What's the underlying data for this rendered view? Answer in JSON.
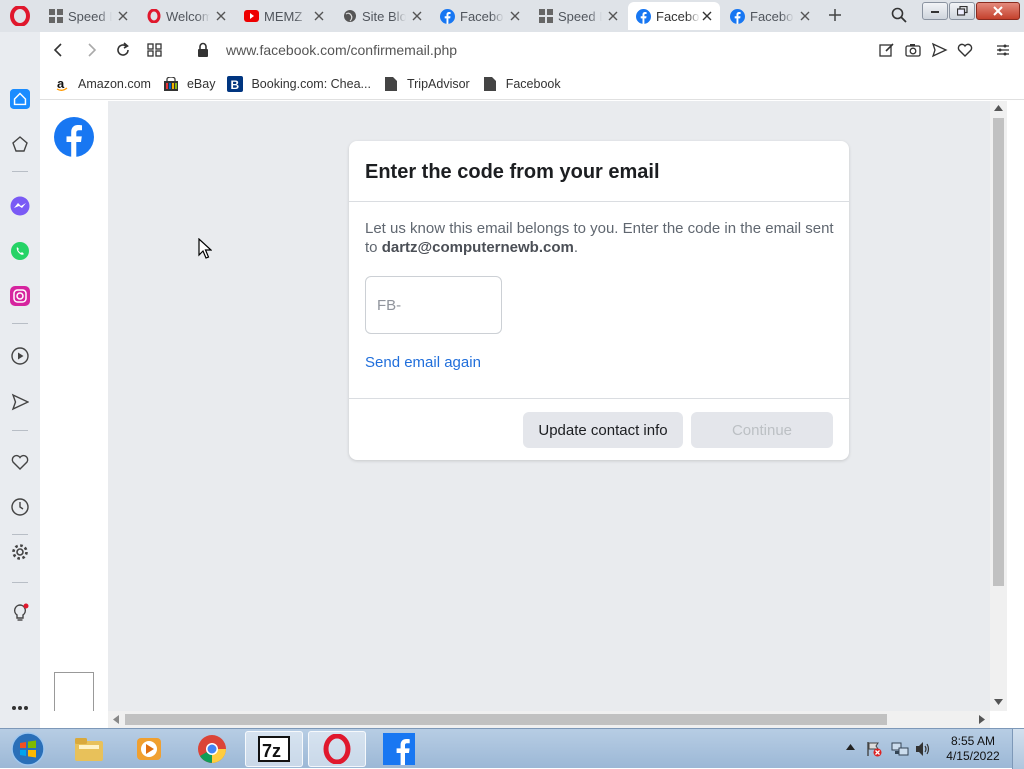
{
  "browser": {
    "tabs": [
      {
        "title": "Speed Dial",
        "icon": "grid-icon",
        "active": false
      },
      {
        "title": "Welcome",
        "icon": "opera-icon",
        "active": false
      },
      {
        "title": "MEMZ",
        "icon": "youtube-icon",
        "active": false
      },
      {
        "title": "Site Blocked",
        "icon": "globe-icon",
        "active": false
      },
      {
        "title": "Facebook",
        "icon": "facebook-icon",
        "active": false
      },
      {
        "title": "Speed Dial",
        "icon": "grid-icon",
        "active": false
      },
      {
        "title": "Facebook",
        "icon": "facebook-icon",
        "active": true
      },
      {
        "title": "Facebook",
        "icon": "facebook-icon",
        "active": false
      }
    ],
    "url": "www.facebook.com/confirmemail.php",
    "bookmarks": [
      {
        "label": "Amazon.com",
        "icon": "amazon-icon"
      },
      {
        "label": "eBay",
        "icon": "ebay-icon"
      },
      {
        "label": "Booking.com: Chea...",
        "icon": "booking-icon"
      },
      {
        "label": "TripAdvisor",
        "icon": "page-icon"
      },
      {
        "label": "Facebook",
        "icon": "page-icon"
      }
    ],
    "accent": "#1877f2"
  },
  "card": {
    "title": "Enter the code from your email",
    "desc_prefix": "Let us know this email belongs to you. Enter the code in the email sent to ",
    "email": "dartz@computernewb.com",
    "desc_suffix": ".",
    "code_placeholder": "FB-",
    "resend_label": "Send email again",
    "update_label": "Update contact info",
    "continue_label": "Continue"
  },
  "taskbar": {
    "time": "8:55 AM",
    "date": "4/15/2022",
    "apps": [
      "explorer-icon",
      "media-player-icon",
      "chrome-icon",
      "7zip-icon",
      "opera-icon",
      "facebook-icon"
    ]
  }
}
